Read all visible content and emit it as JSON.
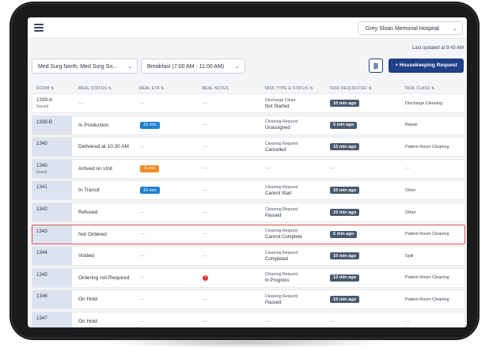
{
  "header": {
    "hospital": "Grey Sloan Memorial Hospital",
    "last_updated": "Last updated at 9:43 AM"
  },
  "filters": {
    "unit": "Med Surg North, Med Surg So...",
    "meal": "Breakfast (7:00 AM - 11:00 AM)"
  },
  "actions": {
    "housekeeping": "+ Housekeeping Request"
  },
  "columns": {
    "room": "ROOM ⇅",
    "meal_status": "MEAL STATUS ⇅",
    "meal_eta": "MEAL ETA ⇅",
    "meal_notes": "MEAL NOTES",
    "task_type": "TASK TYPE & STATUS ⇅",
    "task_requested": "TASK REQUESTED ⇅",
    "task_class": "TASK CLASS ⇅"
  },
  "rows": [
    {
      "room": "1339-A",
      "room_sub": "Vacant",
      "meal_status": "---",
      "eta": "---",
      "eta_color": "",
      "notes": "---",
      "task_type": "Discharge Clean",
      "task_status": "Not Started",
      "requested": "10 min ago",
      "task_class": "Discharge Cleaning"
    },
    {
      "room": "1339-B",
      "room_sub": "",
      "meal_status": "In Production",
      "eta": "15 min",
      "eta_color": "blue",
      "notes": "---",
      "task_type": "Cleaning Request",
      "task_status": "Unassigned",
      "requested": "5 min ago",
      "task_class": "Repair"
    },
    {
      "room": "1340",
      "room_sub": "",
      "meal_status": "Delivered at 10:30 AM",
      "eta": "---",
      "eta_color": "",
      "notes": "---",
      "task_type": "Cleaning Request",
      "task_status": "Cancelled",
      "requested": "15 min ago",
      "task_class": "Patient Room Cleaning"
    },
    {
      "room": "1340",
      "room_sub": "Guest",
      "meal_status": "Arrived on Unit",
      "eta": "-5 min",
      "eta_color": "orange",
      "notes": "---",
      "task_type": "---",
      "task_status": "",
      "requested": "---",
      "task_class": "---"
    },
    {
      "room": "1341",
      "room_sub": "",
      "meal_status": "In Transit",
      "eta": "10 min",
      "eta_color": "blue",
      "notes": "---",
      "task_type": "Cleaning Request",
      "task_status": "Cannot Start",
      "requested": "10 min ago",
      "task_class": "Other"
    },
    {
      "room": "1342",
      "room_sub": "",
      "meal_status": "Refused",
      "eta": "---",
      "eta_color": "",
      "notes": "---",
      "task_type": "Cleaning Request",
      "task_status": "Paused",
      "requested": "10 min ago",
      "task_class": "Other"
    },
    {
      "room": "1343",
      "room_sub": "",
      "meal_status": "Not Ordered",
      "eta": "---",
      "eta_color": "",
      "notes": "---",
      "task_type": "Cleaning Request",
      "task_status": "Cannot Complete",
      "requested": "5 min ago",
      "task_class": "Patient Room Cleaning",
      "selected": true
    },
    {
      "room": "1344",
      "room_sub": "",
      "meal_status": "Voided",
      "eta": "---",
      "eta_color": "",
      "notes": "---",
      "task_type": "Cleaning Request",
      "task_status": "Completed",
      "requested": "10 min ago",
      "task_class": "Spill"
    },
    {
      "room": "1345",
      "room_sub": "",
      "meal_status": "Ordering not Required",
      "eta": "---",
      "eta_color": "",
      "notes": "!",
      "task_type": "Cleaning Request",
      "task_status": "In Progress",
      "requested": "12 min ago",
      "task_class": "Patient Room Cleaning"
    },
    {
      "room": "1346",
      "room_sub": "",
      "meal_status": "On Hold",
      "eta": "---",
      "eta_color": "",
      "notes": "---",
      "task_type": "Cleaning Request",
      "task_status": "Paused",
      "requested": "10 min ago",
      "task_class": "Patient Room Cleaning"
    },
    {
      "room": "1347",
      "room_sub": "",
      "meal_status": "On Hold",
      "eta": "---",
      "eta_color": "",
      "notes": "---",
      "task_type": "---",
      "task_status": "",
      "requested": "---",
      "task_class": "---"
    }
  ],
  "colors": {
    "primary": "#1f3f86",
    "eta_blue": "#1f7fd1",
    "eta_orange": "#f08a24",
    "time_badge": "#4a5a6e",
    "selected_border": "#d9534f",
    "notes_error": "#d9342b"
  },
  "icons": {
    "menu": "hamburger-menu-icon",
    "dropdown": "chevron-down-icon",
    "settings": "sliders-icon",
    "notes_error": "error-circle-icon"
  }
}
